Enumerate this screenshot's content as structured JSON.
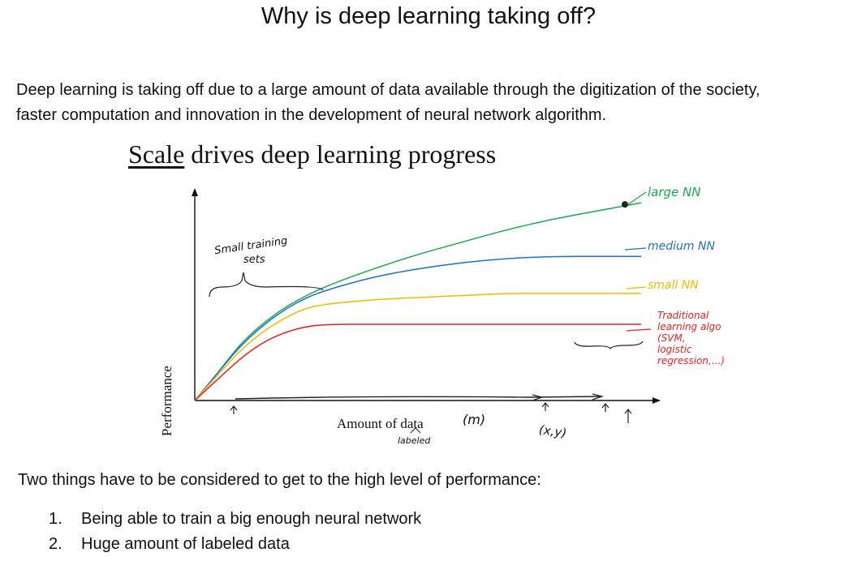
{
  "title": "Why is deep learning taking off?",
  "intro": [
    "Deep learning is taking off due to a large amount of data available through the digitization of the society,",
    "faster computation and innovation in the development of neural network algorithm."
  ],
  "figure": {
    "title_underlined": "Scale",
    "title_rest": " drives deep learning progress",
    "ylabel": "Performance",
    "xlabel": "Amount of data",
    "handwritten": {
      "m": "(m)",
      "labeled": "labeled",
      "xy": "(x,y)",
      "small_training_sets": [
        "Small training",
        "sets"
      ],
      "large_nn": "large NN",
      "medium_nn": "medium NN",
      "small_nn": "small NN",
      "traditional": [
        "Traditional",
        "learning algo",
        "(SVM,",
        "logistic",
        "regression,...)"
      ]
    }
  },
  "chart_data": {
    "type": "line",
    "title": "Scale drives deep learning progress",
    "xlabel": "Amount of data",
    "ylabel": "Performance",
    "x": [
      0,
      0.05,
      0.1,
      0.15,
      0.2,
      0.25,
      0.3,
      0.4,
      0.5,
      0.6,
      0.7,
      0.8,
      0.9,
      1.0
    ],
    "series": [
      {
        "name": "large NN",
        "color": "#1aaa4a",
        "values": [
          0,
          0.13,
          0.27,
          0.37,
          0.45,
          0.51,
          0.56,
          0.64,
          0.71,
          0.77,
          0.83,
          0.88,
          0.92,
          0.96
        ]
      },
      {
        "name": "medium NN",
        "color": "#1f6fd1",
        "values": [
          0,
          0.13,
          0.26,
          0.36,
          0.44,
          0.5,
          0.54,
          0.6,
          0.64,
          0.67,
          0.69,
          0.7,
          0.7,
          0.7
        ]
      },
      {
        "name": "small NN",
        "color": "#f5b800",
        "values": [
          0,
          0.12,
          0.24,
          0.33,
          0.4,
          0.45,
          0.47,
          0.49,
          0.5,
          0.51,
          0.52,
          0.52,
          0.52,
          0.52
        ]
      },
      {
        "name": "Traditional learning algo (SVM, logistic regression,...)",
        "color": "#e8221f",
        "values": [
          0,
          0.1,
          0.2,
          0.28,
          0.33,
          0.36,
          0.37,
          0.37,
          0.37,
          0.37,
          0.37,
          0.37,
          0.37,
          0.37
        ]
      }
    ],
    "xlim": [
      0,
      1
    ],
    "ylim": [
      0,
      1
    ],
    "grid": false
  },
  "subhead": "Two things have to be considered to get to the high level of performance:",
  "list": [
    {
      "num": "1.",
      "text": "Being able to train a big enough neural network"
    },
    {
      "num": "2.",
      "text": "Huge amount of labeled data"
    }
  ]
}
